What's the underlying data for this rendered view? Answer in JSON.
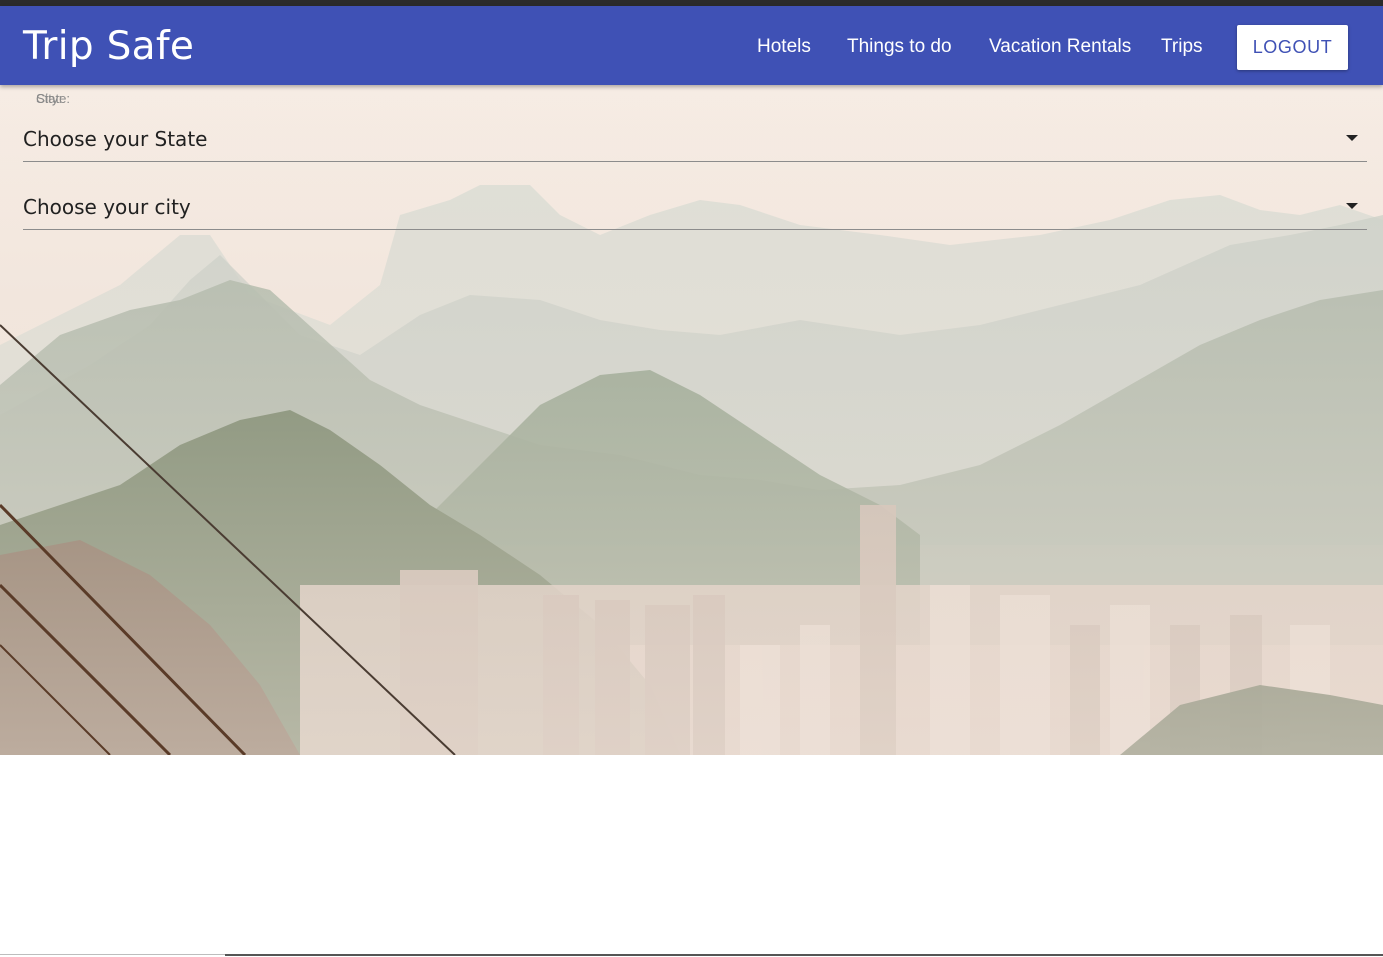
{
  "app": {
    "brand": "Trip Safe"
  },
  "nav": {
    "links": [
      "Hotels",
      "Things to do",
      "Vacation Rentals",
      "Trips"
    ],
    "logout_label": "LOGOUT"
  },
  "form": {
    "state_label": "State:",
    "city_label": "City:",
    "state_select": {
      "value": "Choose your State"
    },
    "city_select": {
      "value": "Choose your city"
    }
  },
  "hero": {
    "image": "misty-mountain-city-landscape"
  },
  "colors": {
    "primary": "#3f51b5",
    "on_primary": "#ffffff",
    "text": "#212121"
  }
}
